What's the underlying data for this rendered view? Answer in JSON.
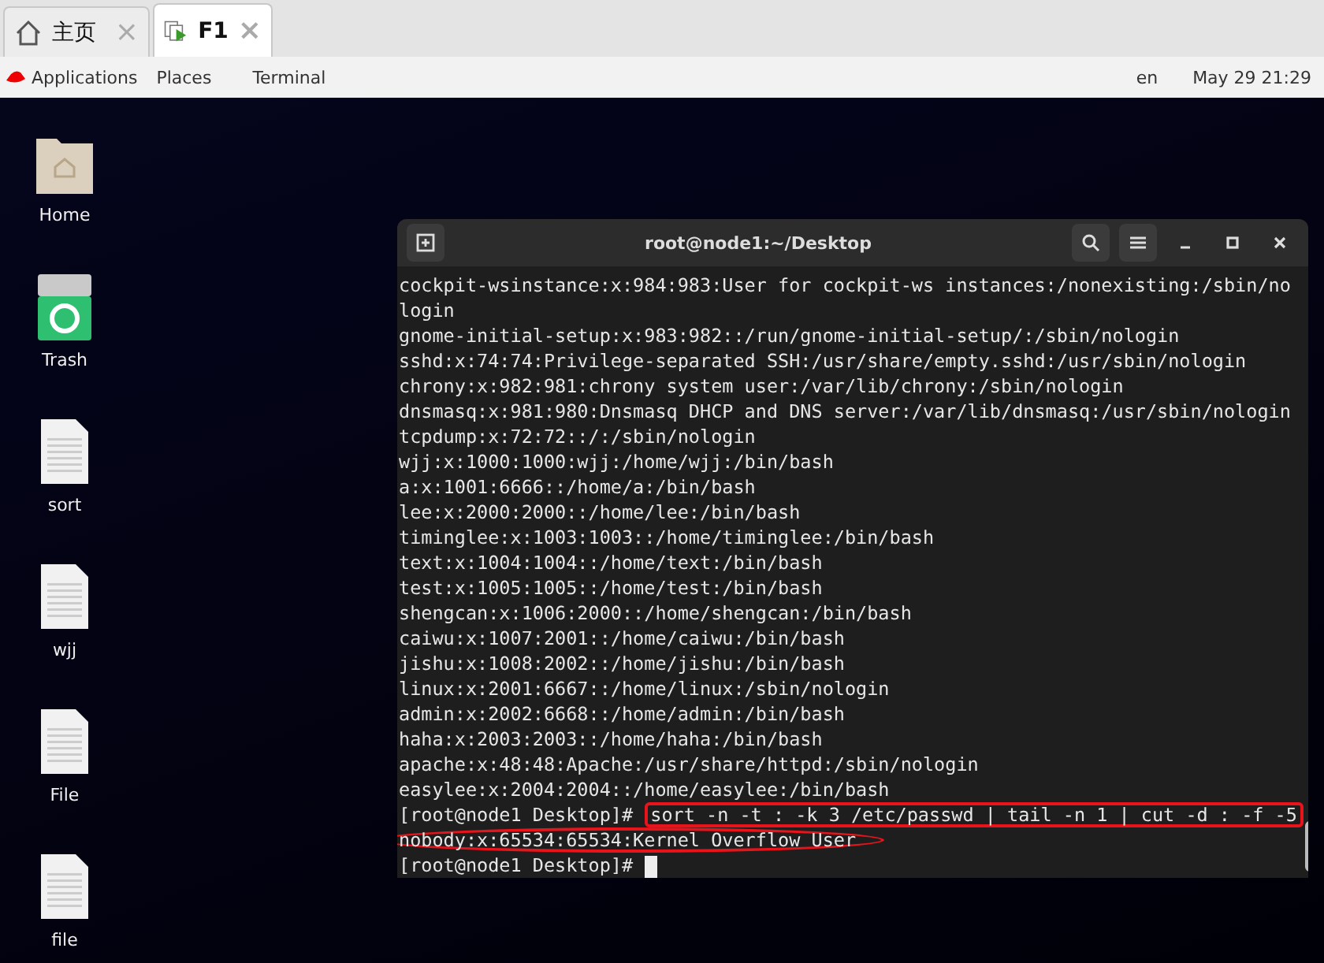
{
  "browser_tabs": [
    {
      "kind": "home",
      "label": "主页",
      "close": "×",
      "selected": false
    },
    {
      "kind": "console",
      "label": "F1",
      "close": "×",
      "selected": true
    }
  ],
  "top_bar": {
    "menus": [
      "Applications",
      "Places",
      "Terminal"
    ],
    "language": "en",
    "clock": "May 29  21:29"
  },
  "desktop_icons": [
    {
      "kind": "folder",
      "label": "Home"
    },
    {
      "kind": "trash",
      "label": "Trash"
    },
    {
      "kind": "file",
      "label": "sort"
    },
    {
      "kind": "file",
      "label": "wjj"
    },
    {
      "kind": "file",
      "label": "File"
    },
    {
      "kind": "file",
      "label": "file"
    }
  ],
  "terminal": {
    "title": "root@node1:~/Desktop",
    "lines": [
      "cockpit-wsinstance:x:984:983:User for cockpit-ws instances:/nonexisting:/sbin/no",
      "login",
      "gnome-initial-setup:x:983:982::/run/gnome-initial-setup/:/sbin/nologin",
      "sshd:x:74:74:Privilege-separated SSH:/usr/share/empty.sshd:/usr/sbin/nologin",
      "chrony:x:982:981:chrony system user:/var/lib/chrony:/sbin/nologin",
      "dnsmasq:x:981:980:Dnsmasq DHCP and DNS server:/var/lib/dnsmasq:/usr/sbin/nologin",
      "tcpdump:x:72:72::/:/sbin/nologin",
      "wjj:x:1000:1000:wjj:/home/wjj:/bin/bash",
      "a:x:1001:6666::/home/a:/bin/bash",
      "lee:x:2000:2000::/home/lee:/bin/bash",
      "timinglee:x:1003:1003::/home/timinglee:/bin/bash",
      "text:x:1004:1004::/home/text:/bin/bash",
      "test:x:1005:1005::/home/test:/bin/bash",
      "shengcan:x:1006:2000::/home/shengcan:/bin/bash",
      "caiwu:x:1007:2001::/home/caiwu:/bin/bash",
      "jishu:x:1008:2002::/home/jishu:/bin/bash",
      "linux:x:2001:6667::/home/linux:/sbin/nologin",
      "admin:x:2002:6668::/home/admin:/bin/bash",
      "haha:x:2003:2003::/home/haha:/bin/bash",
      "apache:x:48:48:Apache:/usr/share/httpd:/sbin/nologin",
      "easylee:x:2004:2004::/home/easylee:/bin/bash"
    ],
    "command": {
      "prompt": "[root@node1 Desktop]#",
      "text": "sort -n -t : -k 3 /etc/passwd | tail -n 1 | cut -d : -f -5"
    },
    "output": "nobody:x:65534:65534:Kernel Overflow User",
    "last_prompt": "[root@node1 Desktop]#"
  }
}
